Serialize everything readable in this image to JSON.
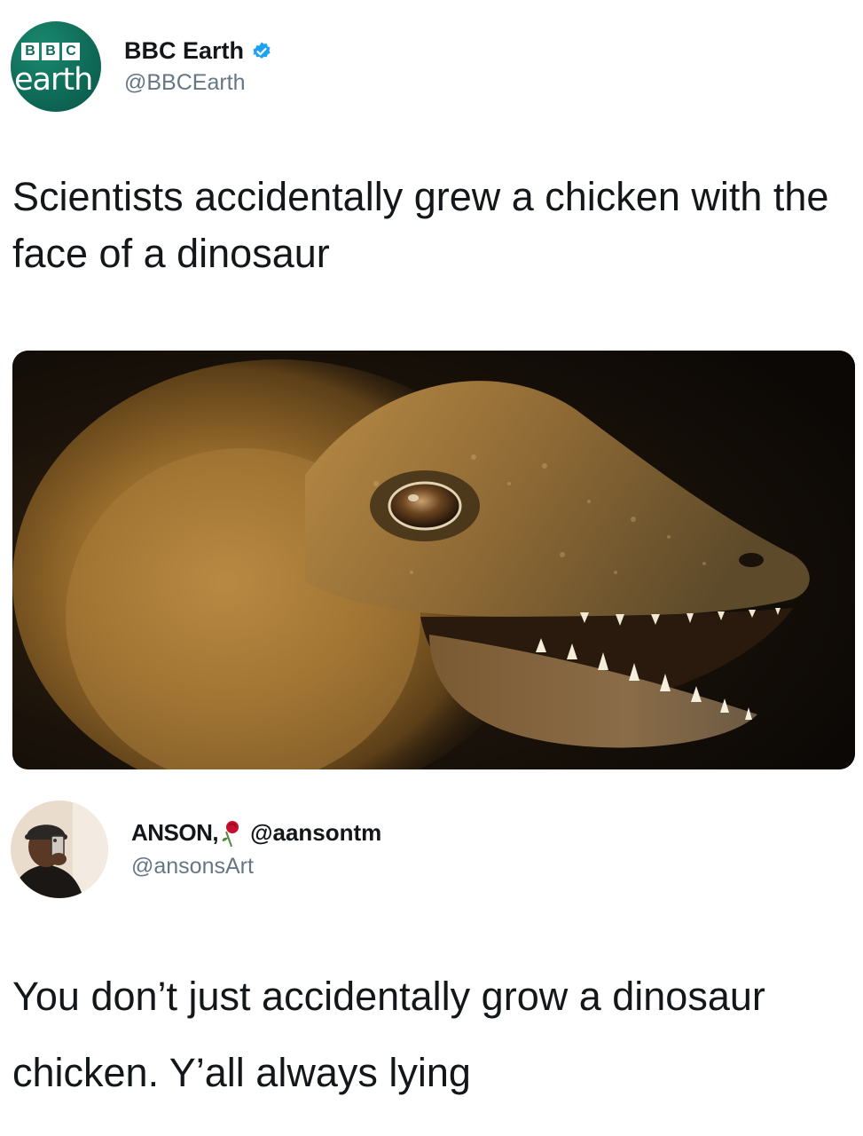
{
  "tweet": {
    "avatar_logo": {
      "letters": [
        "B",
        "B",
        "C"
      ],
      "word": "earth",
      "color": "#0f6b58"
    },
    "display_name": "BBC Earth",
    "verified": true,
    "verified_icon": "verified-badge-icon",
    "verified_color": "#1da1f2",
    "handle": "@BBCEarth",
    "text": "Scientists accidentally grew a chicken with the face of a dinosaur",
    "media": {
      "kind": "photo",
      "icon": "dinosaur-chicken-image"
    }
  },
  "reply": {
    "display_name": "ANSON,",
    "name_icon": "rose-icon",
    "name_extra": "@aansontm",
    "handle": "@ansonsArt",
    "text": "You don’t just accidentally grow a dinosaur chicken. Y’all always lying"
  }
}
